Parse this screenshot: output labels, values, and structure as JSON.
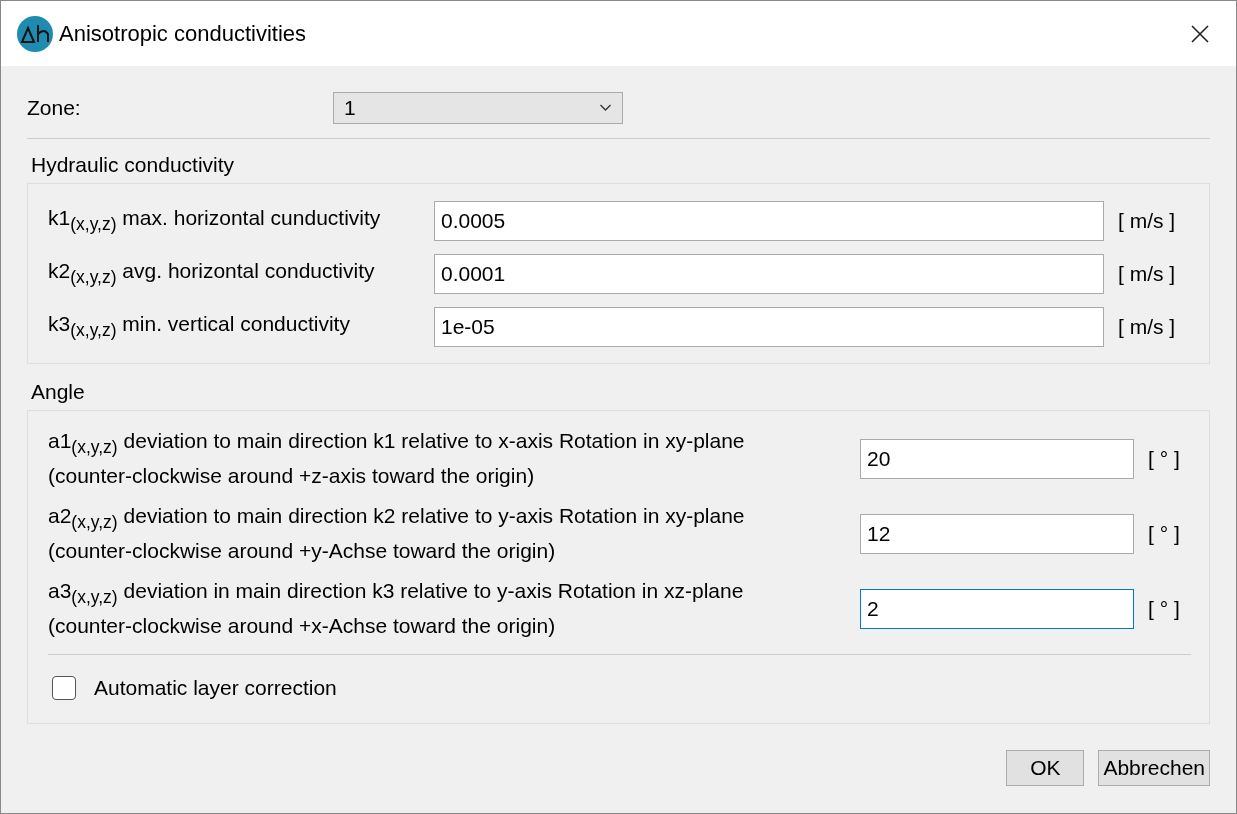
{
  "window": {
    "title": "Anisotropic conductivities"
  },
  "zone": {
    "label": "Zone:",
    "value": "1"
  },
  "hydraulic": {
    "title": "Hydraulic conductivity",
    "rows": [
      {
        "label": "k1$_{(x,y,z)}$ max. horizontal cunductivity",
        "value": "0.0005",
        "unit": "[ m/s ]"
      },
      {
        "label": "k2$_{(x,y,z)}$ avg. horizontal conductivity",
        "value": "0.0001",
        "unit": "[ m/s ]"
      },
      {
        "label": "k3$_{(x,y,z)}$ min. vertical conductivity",
        "value": "1e-05",
        "unit": "[ m/s ]"
      }
    ]
  },
  "angle": {
    "title": "Angle",
    "rows": [
      {
        "label_lines": [
          "a1$_{(x,y,z)}$ deviation to main direction k1 relative to x-axis Rotation in xy-plane",
          "(counter-clockwise around +z-axis toward the origin)"
        ],
        "value": "20",
        "unit": "[ ° ]",
        "focused": false
      },
      {
        "label_lines": [
          "a2$_{(x,y,z)}$ deviation to main direction k2 relative to y-axis Rotation in xy-plane",
          "(counter-clockwise around +y-Achse toward the origin)"
        ],
        "value": "12",
        "unit": "[ ° ]",
        "focused": false
      },
      {
        "label_lines": [
          "a3$_{(x,y,z)}$ deviation in main direction k3 relative to y-axis Rotation in xz-plane",
          "(counter-clockwise around +x-Achse toward the origin)"
        ],
        "value": "2",
        "unit": "[ ° ]",
        "focused": true
      }
    ],
    "checkbox": {
      "label": "Automatic layer correction",
      "checked": false
    }
  },
  "buttons": [
    "OK",
    "Abbrechen"
  ]
}
